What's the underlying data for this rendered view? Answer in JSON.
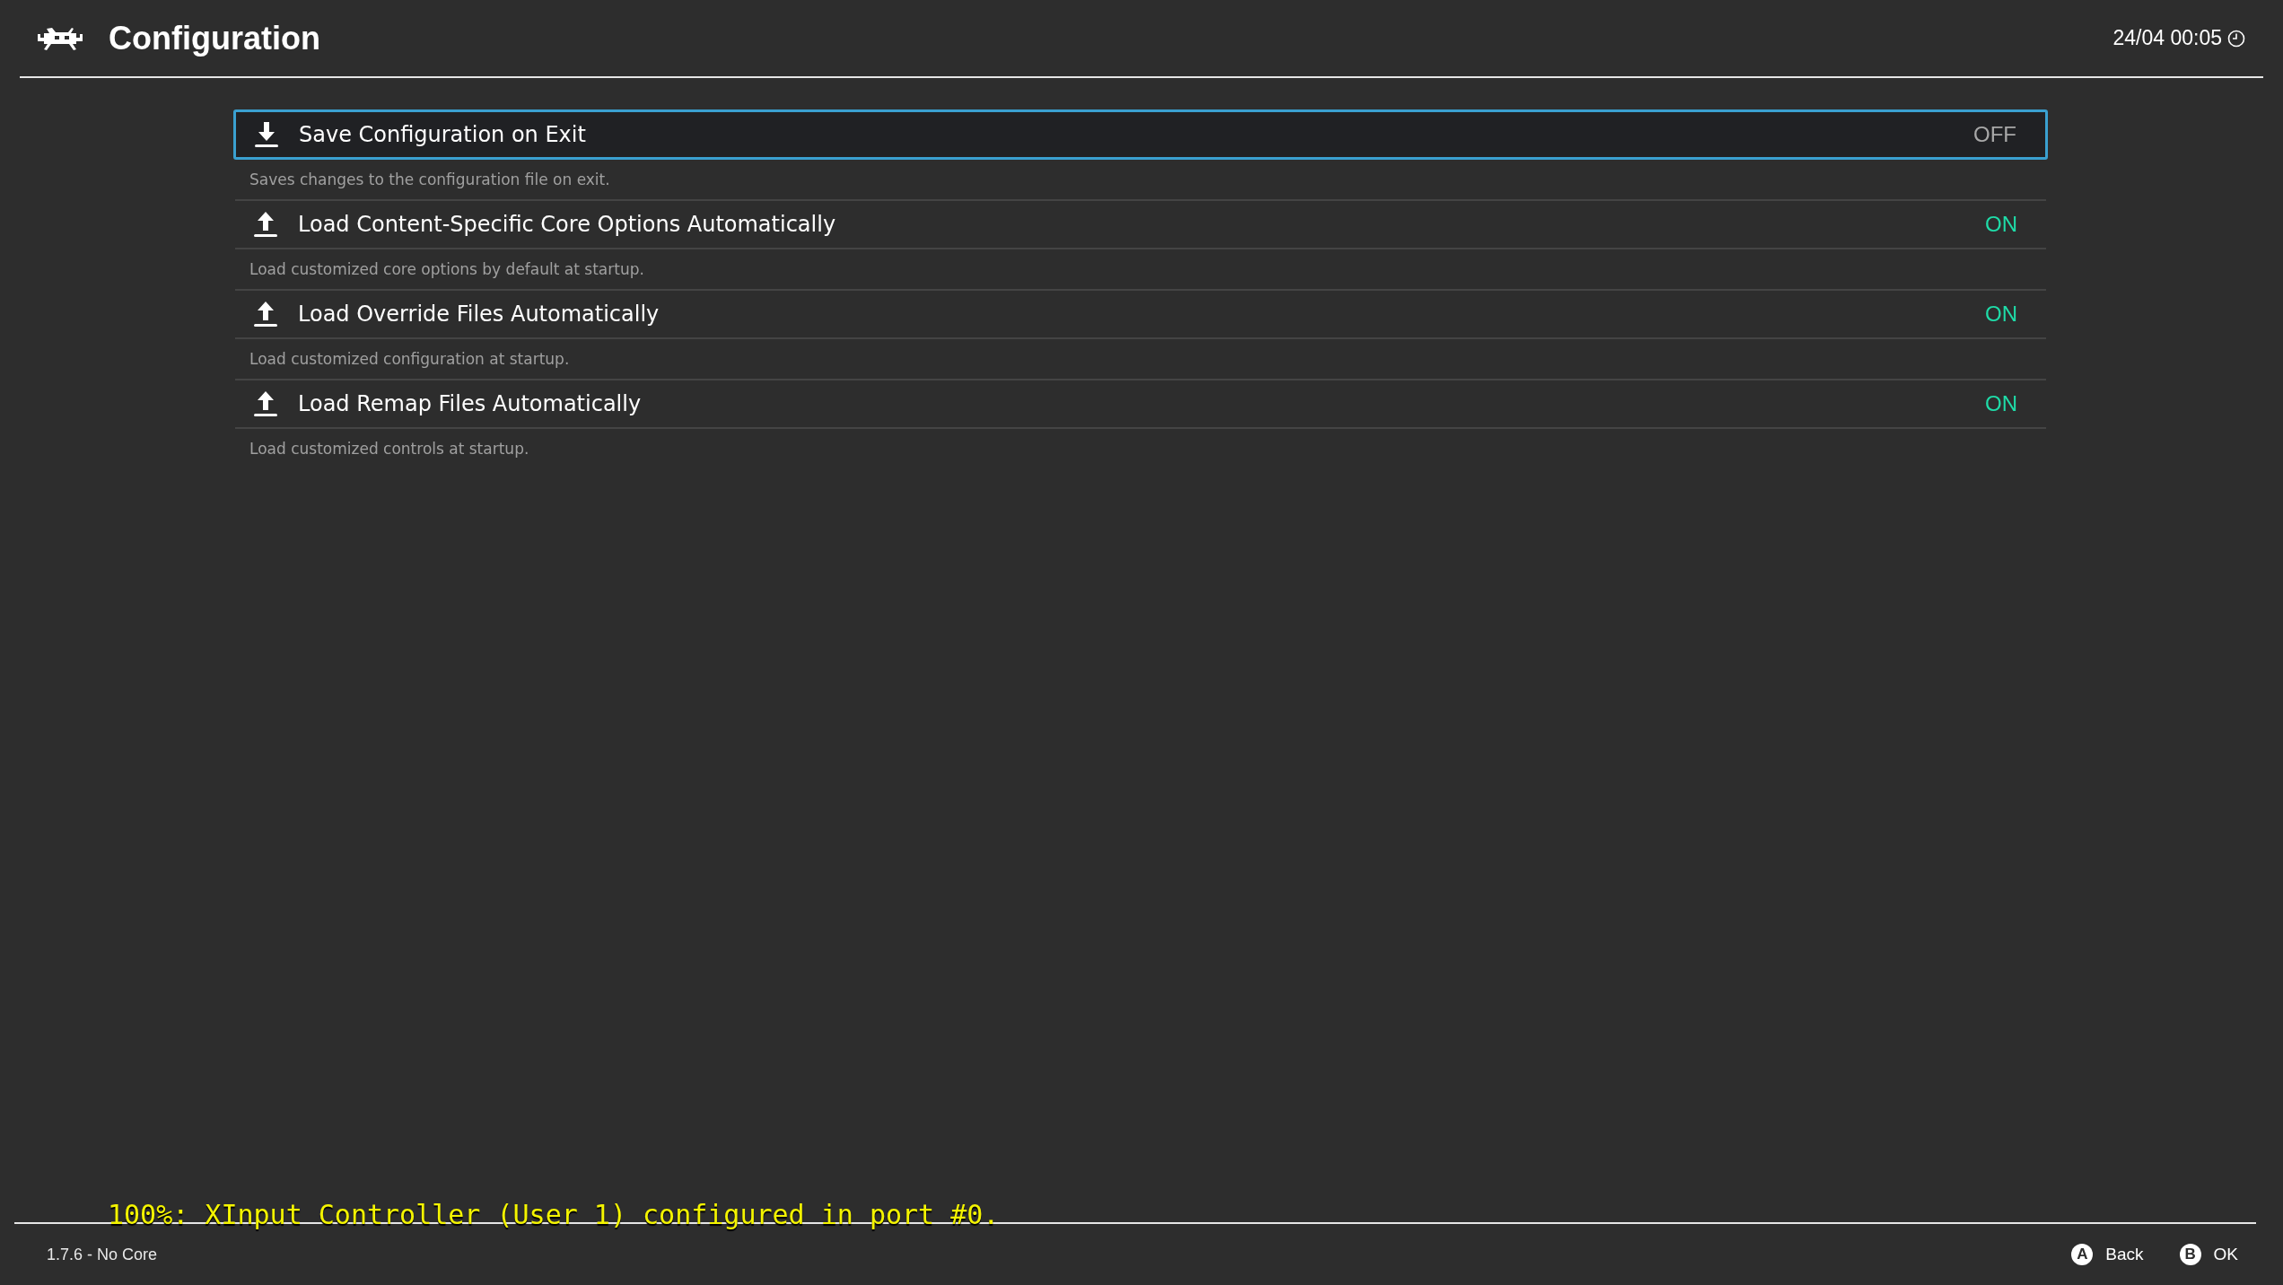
{
  "header": {
    "title": "Configuration",
    "clock": "24/04 00:05"
  },
  "settings": [
    {
      "kind": "download",
      "label": "Save Configuration on Exit",
      "value": "OFF",
      "on": false,
      "selected": true,
      "description": "Saves changes to the configuration file on exit."
    },
    {
      "kind": "upload",
      "label": "Load Content-Specific Core Options Automatically",
      "value": "ON",
      "on": true,
      "selected": false,
      "description": "Load customized core options by default at startup."
    },
    {
      "kind": "upload",
      "label": "Load Override Files Automatically",
      "value": "ON",
      "on": true,
      "selected": false,
      "description": "Load customized configuration at startup."
    },
    {
      "kind": "upload",
      "label": "Load Remap Files Automatically",
      "value": "ON",
      "on": true,
      "selected": false,
      "description": "Load customized controls at startup."
    }
  ],
  "notification": "100%: XInput Controller (User 1) configured in port #0.",
  "footer": {
    "version": "1.7.6 - No Core",
    "buttons": [
      {
        "key": "A",
        "label": "Back"
      },
      {
        "key": "B",
        "label": "OK"
      }
    ]
  }
}
